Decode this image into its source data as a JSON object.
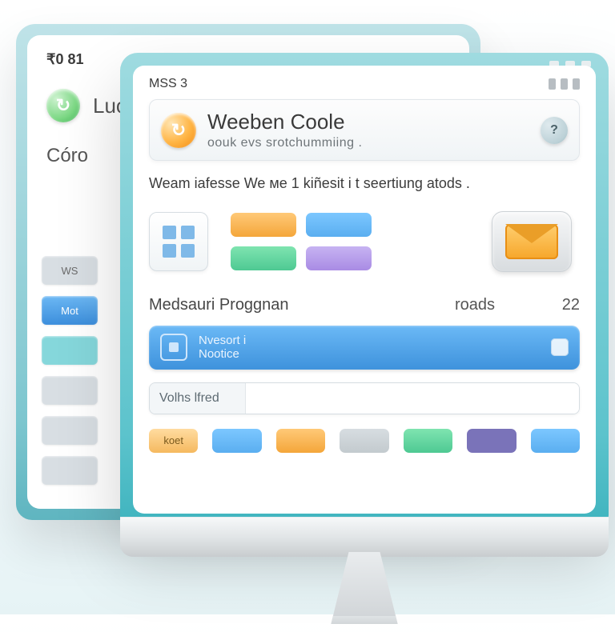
{
  "back": {
    "timestamp": "₹0 81",
    "title": "Luovy",
    "subtitle": "Córo",
    "sidebar": [
      {
        "label": "WS",
        "style": "sb-grey"
      },
      {
        "label": "Mot",
        "style": "sb-blue"
      },
      {
        "label": "",
        "style": "sb-teal"
      }
    ]
  },
  "front": {
    "timestamp": "MSS 3",
    "header": {
      "title": "Weeben Coole",
      "subtitle": "oouk   evs srotchummiing ."
    },
    "intro": "Weam iafesse  We  ме 1 kiñesit i t  seertiung  atods .",
    "stats": {
      "label": "Medsauri Proggnan",
      "col1": "roads",
      "col2": "22"
    },
    "banner": {
      "line1": "Nvesort i",
      "line2": "Nootice"
    },
    "input": {
      "label": "Volhs  lfred",
      "value": ""
    },
    "bottom_chip": "koet",
    "swatch_colors": {
      "top": [
        "sw-orange",
        "sw-blue"
      ],
      "bottom": [
        "sw-green",
        "sw-purple"
      ]
    },
    "bottom_swatch_colors": [
      "sw-blue",
      "sw-orange",
      "sw-grey",
      "sw-green",
      "sw-darkpurple",
      "sw-blue"
    ]
  }
}
